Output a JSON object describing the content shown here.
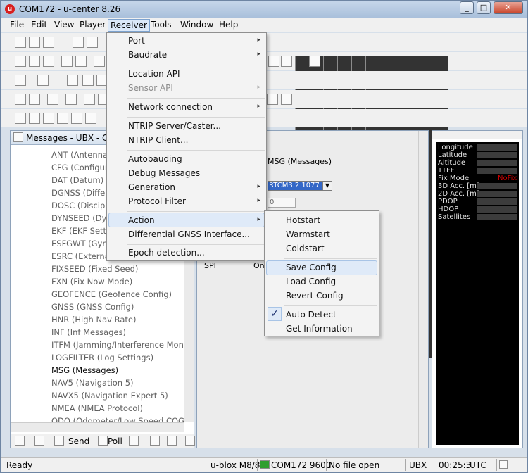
{
  "window": {
    "title": "COM172 - u-center 8.26",
    "app_icon": "u"
  },
  "window_controls": {
    "minimize": "_",
    "maximize": "□",
    "close": "✕"
  },
  "menubar": [
    "File",
    "Edit",
    "View",
    "Player",
    "Receiver",
    "Tools",
    "Window",
    "Help"
  ],
  "messages_panel": {
    "title": "Messages - UBX - CF",
    "tree_items": [
      "ANT (Antenna S",
      "CFG (Configura",
      "DAT (Datum)",
      "DGNSS (Differe",
      "DOSC (Disciplin",
      "DYNSEED (Dyna",
      "EKF (EKF Setting",
      "ESFGWT (Gyro-",
      "ESRC (External",
      "FIXSEED (Fixed Seed)",
      "FXN (Fix Now Mode)",
      "GEOFENCE (Geofence Config)",
      "GNSS (GNSS Config)",
      "HNR (High Nav Rate)",
      "INF (Inf Messages)",
      "ITFM (Jamming/Interference Monito",
      "LOGFILTER (Log Settings)",
      "MSG (Messages)",
      "NAV5 (Navigation 5)",
      "NAVX5 (Navigation Expert 5)",
      "NMEA (NMEA Protocol)",
      "ODO (Odometer/Low Speed COG F"
    ],
    "selected": "MSG (Messages)",
    "bottom": {
      "send": "Send",
      "poll": "Poll"
    }
  },
  "config_panel": {
    "caption": "MSG (Messages)",
    "message_select": "RTCM3.2 1077",
    "rate_value": "0",
    "row_label": "SPI",
    "row_value": "On"
  },
  "data_view": {
    "labels": [
      "Longitude",
      "Latitude",
      "Altitude",
      "TTFF",
      "Fix Mode",
      "3D Acc. [m]",
      "2D Acc. [m]",
      "PDOP",
      "HDOP",
      "Satellites"
    ],
    "fix_mode_value": "NoFix"
  },
  "receiver_menu": {
    "items": [
      "Port",
      "Baudrate",
      "Location API",
      "Sensor API",
      "Network connection",
      "NTRIP Server/Caster...",
      "NTRIP Client...",
      "Autobauding",
      "Debug Messages",
      "Generation",
      "Protocol Filter",
      "Action",
      "Differential GNSS Interface...",
      "Epoch detection..."
    ],
    "submenu_indicator": "▸"
  },
  "action_submenu": {
    "items": [
      "Hotstart",
      "Warmstart",
      "Coldstart",
      "Save Config",
      "Load Config",
      "Revert Config",
      "Auto Detect",
      "Get Information"
    ],
    "highlighted": "Save Config",
    "checked": "Auto Detect",
    "check_mark": "✓"
  },
  "statusbar": {
    "ready": "Ready",
    "receiver": "u-blox M8/8",
    "port": "COM172 9600",
    "file": "No file open",
    "protocol": "UBX",
    "time": "00:25:3",
    "tz": "UTC"
  }
}
